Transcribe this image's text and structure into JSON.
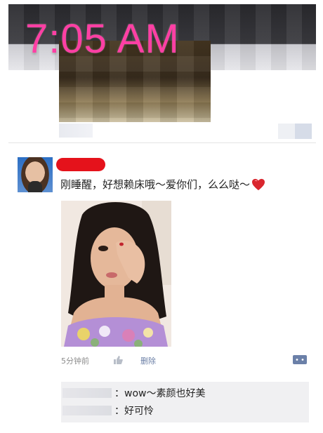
{
  "overlay": {
    "time": "7:05 AM"
  },
  "post": {
    "text": "刚睡醒，好想赖床哦～爱你们，么么哒～",
    "time": "5分钟前",
    "delete_label": "删除"
  },
  "comments": [
    {
      "text": "：wow～素颜也好美"
    },
    {
      "text": "：好可怜"
    }
  ],
  "colors": {
    "overlay_time": "#ff3fa4",
    "redaction": "#e5121b",
    "link": "#6b7fa6",
    "heart": "#d9262e"
  },
  "icons": {
    "heart": "heart-icon",
    "like": "like-icon",
    "comment": "comment-icon"
  }
}
